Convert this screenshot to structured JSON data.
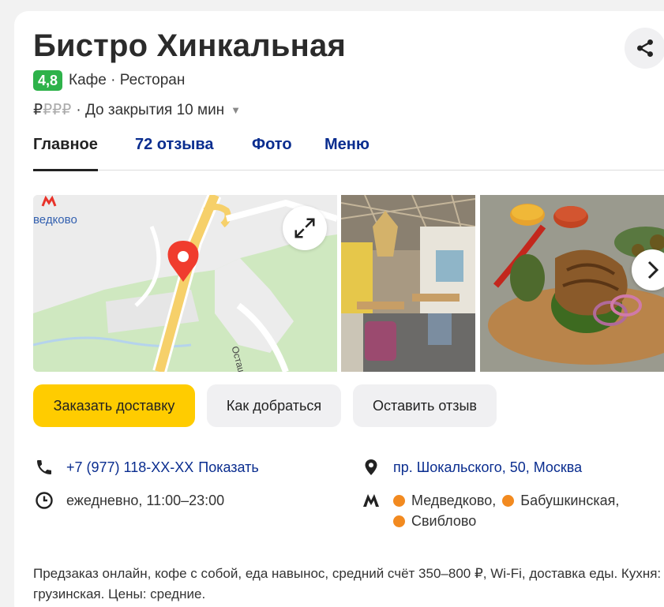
{
  "place": {
    "name": "Бистро Хинкальная",
    "rating": "4,8",
    "categories": "Кафе · Ресторан",
    "price_level_on": "₽",
    "price_level_off": "₽₽₽",
    "status": "· До закрытия 10 мин"
  },
  "tabs": [
    {
      "label": "Главное"
    },
    {
      "label": "72 отзыва"
    },
    {
      "label": "Фото"
    },
    {
      "label": "Меню"
    }
  ],
  "map": {
    "metro_label": "ведково",
    "street_label": "Осташковс"
  },
  "actions": {
    "delivery": "Заказать доставку",
    "directions": "Как добраться",
    "review": "Оставить отзыв"
  },
  "contacts": {
    "phone": "+7 (977) 118-XX-XX",
    "phone_show": "Показать",
    "hours": "ежедневно, 11:00–23:00",
    "address": "пр. Шокальского, 50, Москва",
    "metro": [
      "Медведково,",
      "Бабушкинская,",
      "Свиблово"
    ]
  },
  "description": "Предзаказ онлайн, кофе с собой, еда навынос, средний счёт 350–800 ₽, Wi-Fi, доставка еды. Кухня: грузинская. Цены: средние.",
  "icons": {
    "share": "share-icon",
    "expand": "expand-icon",
    "phone": "phone-icon",
    "clock": "clock-icon",
    "pin": "location-pin-icon",
    "metro": "metro-icon"
  },
  "colors": {
    "rating_bg": "#2eb24a",
    "primary_button": "#ffcc00",
    "link": "#0a2d8f",
    "metro_line": "#f28a20",
    "map_marker": "#f03c2e"
  }
}
